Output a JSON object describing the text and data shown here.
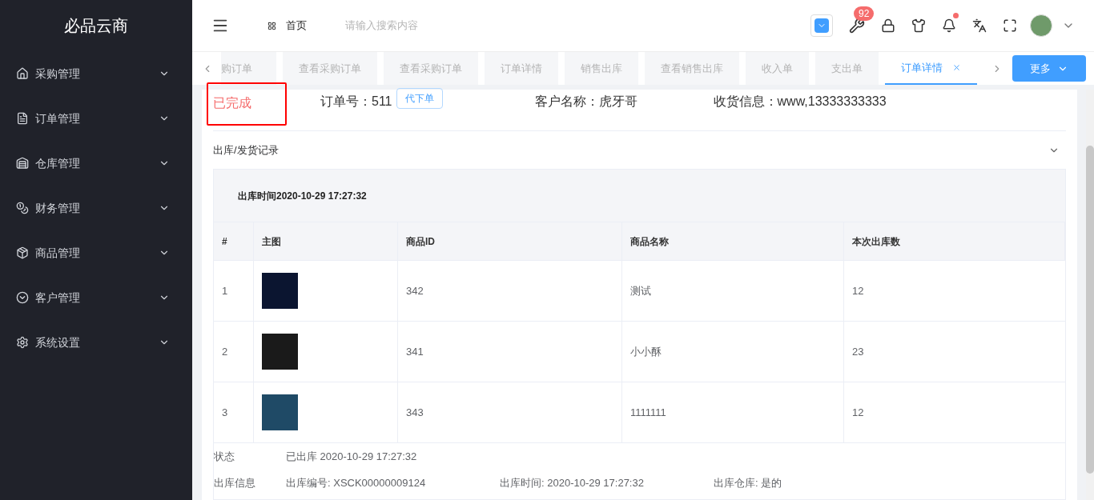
{
  "sidebar": {
    "logo": "必品云商",
    "items": [
      {
        "label": "采购管理",
        "expanded": false
      },
      {
        "label": "订单管理",
        "expanded": false
      },
      {
        "label": "仓库管理",
        "expanded": false
      },
      {
        "label": "财务管理",
        "expanded": false
      },
      {
        "label": "商品管理",
        "expanded": false
      },
      {
        "label": "客户管理",
        "expanded": false
      },
      {
        "label": "系统设置",
        "expanded": false
      }
    ]
  },
  "header": {
    "breadcrumb": "首页",
    "search": {
      "placeholder": "请输入搜索内容"
    },
    "badge": "92",
    "notification_dot": true
  },
  "tabs": [
    {
      "label": "购订单",
      "selected": false
    },
    {
      "label": "查看采购订单",
      "selected": false
    },
    {
      "label": "查看采购订单",
      "selected": false
    },
    {
      "label": "订单详情",
      "selected": false
    },
    {
      "label": "销售出库",
      "selected": false
    },
    {
      "label": "查看销售出库",
      "selected": false
    },
    {
      "label": "收入单",
      "selected": false
    },
    {
      "label": "支出单",
      "selected": false
    },
    {
      "label": "订单详情",
      "selected": true
    }
  ],
  "more_button": "更多",
  "order": {
    "status": "已完成",
    "number": "订单号：511",
    "action": "代下单",
    "customer": "客户名称：虎牙哥",
    "shipping": "收货信息：www,13333333333"
  },
  "section": {
    "title": "出库/发货记录",
    "expanded": true,
    "record": {
      "time": "出库时间2020-10-29 17:27:32",
      "columns": [
        "#",
        "主图",
        "商品ID",
        "商品名称",
        "本次出库数"
      ],
      "rows": [
        {
          "index": "1",
          "id": "342",
          "name": "测试",
          "qty": "12"
        },
        {
          "index": "2",
          "id": "341",
          "name": "小小酥",
          "qty": "23"
        },
        {
          "index": "3",
          "id": "343",
          "name": "1111111",
          "qty": "12"
        }
      ],
      "status_label": "状态",
      "status_value": "已出库 2020-10-29 17:27:32",
      "info_label": "出库信息",
      "info": [
        "出库编号: XSCK00000009124",
        "出库时间: 2020-10-29 17:27:32",
        "出库仓库: 是的"
      ]
    }
  }
}
